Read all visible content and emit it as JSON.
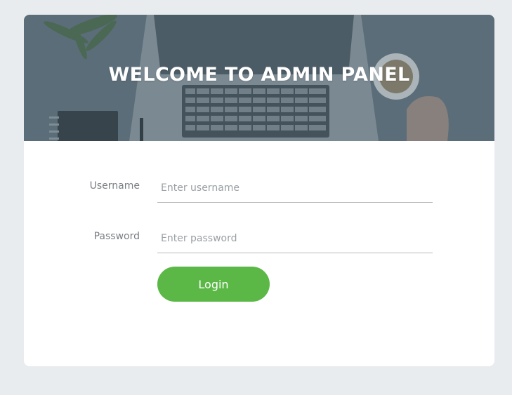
{
  "header": {
    "title": "WELCOME TO ADMIN PANEL"
  },
  "form": {
    "username_label": "Username",
    "username_placeholder": "Enter username",
    "username_value": "",
    "password_label": "Password",
    "password_placeholder": "Enter password",
    "password_value": "",
    "login_label": "Login"
  },
  "colors": {
    "page_background": "#e9ecee",
    "card_background": "#ffffff",
    "hero_tint": "#5f717c",
    "accent_green": "#5bb847",
    "label_text": "#7a7f84"
  }
}
